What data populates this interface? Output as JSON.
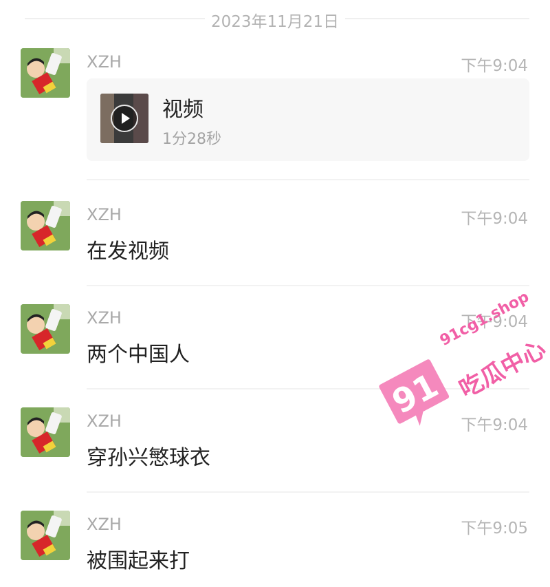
{
  "date_separator": "2023年11月21日",
  "video_message": {
    "sender": "XZH",
    "time": "下午9:04",
    "title": "视频",
    "duration": "1分28秒"
  },
  "messages": [
    {
      "sender": "XZH",
      "time": "下午9:04",
      "text": "在发视频"
    },
    {
      "sender": "XZH",
      "time": "下午9:04",
      "text": "两个中国人"
    },
    {
      "sender": "XZH",
      "time": "下午9:04",
      "text": "穿孙兴慜球衣"
    },
    {
      "sender": "XZH",
      "time": "下午9:05",
      "text": "被围起来打"
    }
  ],
  "watermark": {
    "badge": "91",
    "site": "91cg1.shop",
    "name": "吃瓜中心"
  },
  "colors": {
    "background": "#ffffff",
    "meta_text": "#b3b3b3",
    "card_bg": "#f7f7f7",
    "watermark": "#f15fa6"
  }
}
